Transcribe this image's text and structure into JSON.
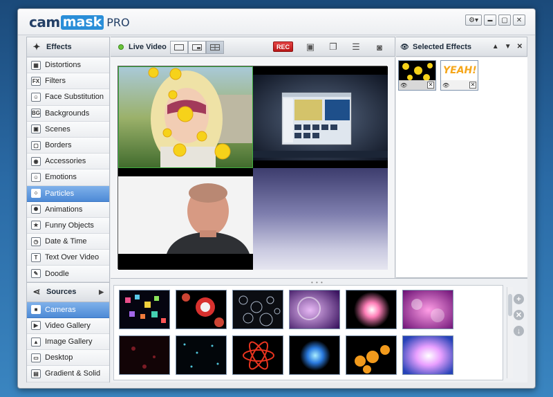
{
  "app": {
    "logo_cam": "cam",
    "logo_mask": "mask",
    "logo_pro": "PRO",
    "gear_symbol": "⚙▾",
    "minimize_symbol": "▬",
    "maximize_symbol": "▢",
    "close_symbol": "✕"
  },
  "sidebar": {
    "effects_header": "Effects",
    "effects_items": [
      {
        "label": "Distortions",
        "icon": "distortion-icon",
        "glyph": "▦"
      },
      {
        "label": "Filters",
        "icon": "filter-icon",
        "glyph": "FX"
      },
      {
        "label": "Face Substitution",
        "icon": "face-substitution-icon",
        "glyph": "☺"
      },
      {
        "label": "Backgrounds",
        "icon": "backgrounds-icon",
        "glyph": "BG"
      },
      {
        "label": "Scenes",
        "icon": "scenes-icon",
        "glyph": "▣"
      },
      {
        "label": "Borders",
        "icon": "borders-icon",
        "glyph": "▢"
      },
      {
        "label": "Accessories",
        "icon": "accessories-icon",
        "glyph": "◉"
      },
      {
        "label": "Emotions",
        "icon": "emotions-icon",
        "glyph": "☺"
      },
      {
        "label": "Particles",
        "icon": "particles-icon",
        "glyph": "⁘"
      },
      {
        "label": "Animations",
        "icon": "animations-icon",
        "glyph": "✺"
      },
      {
        "label": "Funny Objects",
        "icon": "funny-objects-icon",
        "glyph": "★"
      },
      {
        "label": "Date & Time",
        "icon": "date-time-icon",
        "glyph": "◷"
      },
      {
        "label": "Text Over Video",
        "icon": "text-over-video-icon",
        "glyph": "T"
      },
      {
        "label": "Doodle",
        "icon": "doodle-icon",
        "glyph": "✎"
      }
    ],
    "sources_header": "Sources",
    "sources_arrow": "▶",
    "sources_items": [
      {
        "label": "Cameras",
        "icon": "camera-icon",
        "glyph": "■"
      },
      {
        "label": "Video Gallery",
        "icon": "video-gallery-icon",
        "glyph": "▶"
      },
      {
        "label": "Image Gallery",
        "icon": "image-gallery-icon",
        "glyph": "▲"
      },
      {
        "label": "Desktop",
        "icon": "desktop-icon",
        "glyph": "▭"
      },
      {
        "label": "Gradient & Solid",
        "icon": "gradient-solid-icon",
        "glyph": "▤"
      }
    ],
    "active_effect": "Particles",
    "active_source": "Cameras"
  },
  "toolbar": {
    "live_label": "Live Video",
    "rec_label": "REC"
  },
  "selected_effects": {
    "title": "Selected Effects",
    "up_symbol": "▲",
    "down_symbol": "▼",
    "close_symbol": "✕",
    "items": [
      {
        "name": "sun-effect",
        "text": ""
      },
      {
        "name": "yeah-effect",
        "text": "YEAH!"
      }
    ],
    "eye_symbol": "👁",
    "remove_symbol": "✕"
  },
  "gallery": {
    "grip": "• • •",
    "add_symbol": "+",
    "remove_symbol": "✕",
    "download_symbol": "↓"
  },
  "colors": {
    "accent": "#4d8ad6",
    "rec": "#d22a2a",
    "live": "#69c43a"
  }
}
